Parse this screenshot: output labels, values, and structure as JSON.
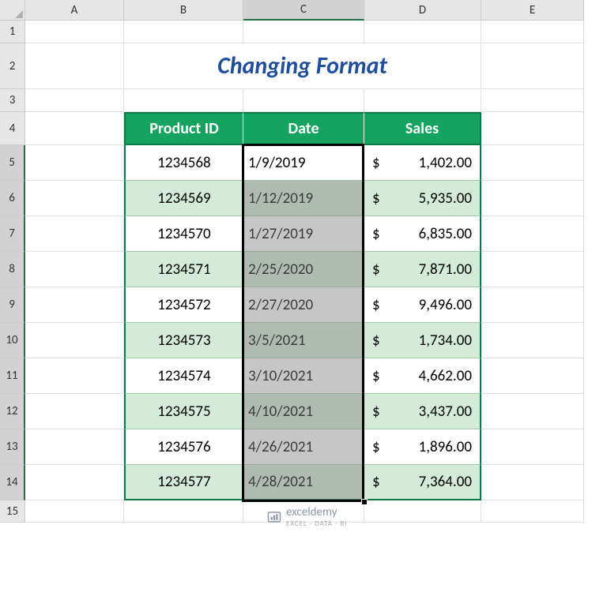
{
  "columns": [
    "A",
    "B",
    "C",
    "D",
    "E"
  ],
  "active_col": "C",
  "rows": [
    1,
    2,
    3,
    4,
    5,
    6,
    7,
    8,
    9,
    10,
    11,
    12,
    13,
    14,
    15
  ],
  "active_rows_start": 5,
  "active_rows_end": 14,
  "title": "Changing Format",
  "headers": {
    "b": "Product ID",
    "c": "Date",
    "d": "Sales"
  },
  "data": [
    {
      "id": "1234568",
      "date": "1/9/2019",
      "sales": "1,402.00"
    },
    {
      "id": "1234569",
      "date": "1/12/2019",
      "sales": "5,935.00"
    },
    {
      "id": "1234570",
      "date": "1/27/2019",
      "sales": "6,835.00"
    },
    {
      "id": "1234571",
      "date": "2/25/2020",
      "sales": "7,871.00"
    },
    {
      "id": "1234572",
      "date": "2/27/2020",
      "sales": "9,496.00"
    },
    {
      "id": "1234573",
      "date": "3/5/2021",
      "sales": "1,734.00"
    },
    {
      "id": "1234574",
      "date": "3/10/2021",
      "sales": "4,662.00"
    },
    {
      "id": "1234575",
      "date": "4/10/2021",
      "sales": "3,437.00"
    },
    {
      "id": "1234576",
      "date": "4/26/2021",
      "sales": "1,896.00"
    },
    {
      "id": "1234577",
      "date": "4/28/2021",
      "sales": "7,364.00"
    }
  ],
  "currency": "$",
  "watermark": {
    "name": "exceldemy",
    "sub": "EXCEL · DATA · BI"
  },
  "row_heights": {
    "r1": 29,
    "r2": 58,
    "r3": 29,
    "r4": 42,
    "data": 45,
    "r15": 28
  },
  "col_widths": {
    "A": 125,
    "B": 151,
    "C": 153,
    "D": 148,
    "E": 130
  }
}
